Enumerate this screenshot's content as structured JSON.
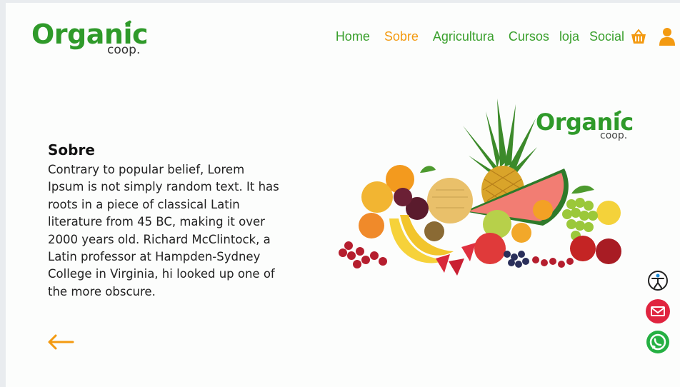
{
  "brand": {
    "name": "Organic",
    "sub": "coop."
  },
  "nav": {
    "items": [
      {
        "label": "Home",
        "active": false
      },
      {
        "label": "Sobre",
        "active": true
      },
      {
        "label": "Agricultura",
        "active": false
      },
      {
        "label": "Cursos",
        "active": false
      },
      {
        "label": "loja",
        "active": false
      },
      {
        "label": "Social",
        "active": false
      }
    ],
    "cart_icon": "basket-icon",
    "user_icon": "user-icon"
  },
  "content": {
    "title": "Sobre",
    "text": "Contrary to popular belief, Lorem Ipsum is not simply random text. It has roots in a piece of classical Latin literature from 45 BC, making it over 2000 years old. Richard McClintock, a Latin professor at Hampden-Sydney College in Virginia, hi looked up one of the more obscure.",
    "back_icon": "arrow-left-icon"
  },
  "hero": {
    "image": "fruit-pile-image",
    "brand": {
      "name": "Organic",
      "sub": "coop."
    }
  },
  "floating": [
    {
      "icon": "accessibility-icon"
    },
    {
      "icon": "email-icon"
    },
    {
      "icon": "whatsapp-icon"
    }
  ],
  "colors": {
    "brand_green": "#2f9a2a",
    "nav_green": "#3aa02d",
    "accent_orange": "#f39a11",
    "email_red": "#e0243f",
    "whatsapp_green": "#25b043"
  }
}
